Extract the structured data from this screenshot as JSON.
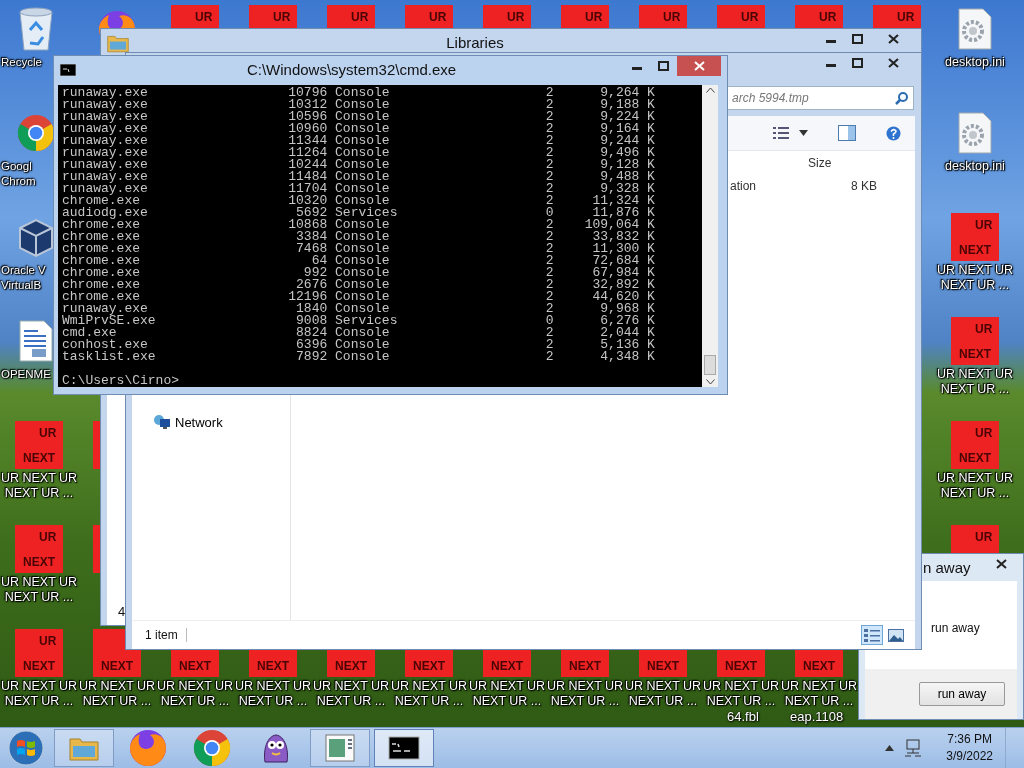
{
  "desktop": {
    "icons": [
      {
        "kind": "recycle-bin",
        "label": [
          "Recycle"
        ]
      },
      {
        "kind": "firefox"
      },
      {
        "kind": "tile",
        "top": "UR"
      },
      {
        "kind": "tile",
        "top": "UR"
      },
      {
        "kind": "tile",
        "top": "UR"
      },
      {
        "kind": "tile",
        "top": "UR"
      },
      {
        "kind": "tile",
        "top": "UR"
      },
      {
        "kind": "tile",
        "top": "UR"
      },
      {
        "kind": "tile",
        "top": "UR"
      },
      {
        "kind": "tile",
        "top": "UR"
      },
      {
        "kind": "tile",
        "top": "UR"
      },
      {
        "kind": "tile",
        "top": "UR"
      },
      {
        "kind": "settings-file",
        "label": [
          "desktop.ini"
        ]
      },
      {
        "kind": "chrome",
        "label": [
          "Googl",
          "Chrom"
        ]
      },
      {
        "kind": "settings-file",
        "label": [
          "desktop.ini"
        ]
      },
      {
        "kind": "virtualbox",
        "label": [
          "Oracle V",
          "VirtualB"
        ]
      },
      {
        "kind": "tile",
        "top": "UR",
        "bottom": "NEXT",
        "label": [
          "UR NEXT UR",
          "NEXT UR ..."
        ]
      },
      {
        "kind": "document",
        "label": [
          "OPENME"
        ]
      },
      {
        "kind": "tile",
        "top": "UR",
        "bottom": "NEXT",
        "label": [
          "UR NEXT UR",
          "NEXT UR ..."
        ]
      },
      {
        "kind": "tile",
        "top": "UR",
        "bottom": "NEXT",
        "label": [
          "UR NEXT UR",
          "NEXT UR ..."
        ]
      },
      {
        "kind": "tile"
      },
      {
        "kind": "tile",
        "top": "UR",
        "bottom": "NEXT",
        "label": [
          "UR NEXT UR",
          "NEXT UR ..."
        ]
      },
      {
        "kind": "tile",
        "top": "UR",
        "bottom": "NEXT",
        "label": [
          "UR NEXT UR",
          "NEXT UR ..."
        ]
      },
      {
        "kind": "tile"
      },
      {
        "kind": "tile",
        "top": "UR"
      },
      {
        "kind": "tile",
        "top": "UR",
        "bottom": "NEXT",
        "label": [
          "UR NEXT UR",
          "NEXT UR ..."
        ]
      },
      {
        "kind": "tile",
        "bottom": "NEXT",
        "label": [
          "UR NEXT UR",
          "NEXT UR ..."
        ]
      },
      {
        "kind": "tile",
        "bottom": "NEXT",
        "label": [
          "UR NEXT UR",
          "NEXT UR ..."
        ]
      },
      {
        "kind": "tile",
        "bottom": "NEXT",
        "label": [
          "UR NEXT UR",
          "NEXT UR ..."
        ]
      },
      {
        "kind": "tile",
        "bottom": "NEXT",
        "label": [
          "UR NEXT UR",
          "NEXT UR ..."
        ]
      },
      {
        "kind": "tile",
        "bottom": "NEXT",
        "label": [
          "UR NEXT UR",
          "NEXT UR ..."
        ]
      },
      {
        "kind": "tile",
        "bottom": "NEXT",
        "label": [
          "UR NEXT UR",
          "NEXT UR ..."
        ]
      },
      {
        "kind": "tile",
        "bottom": "NEXT",
        "label": [
          "UR NEXT UR",
          "NEXT UR ..."
        ]
      },
      {
        "kind": "tile",
        "bottom": "NEXT",
        "label": [
          "UR NEXT UR",
          "NEXT UR ..."
        ]
      },
      {
        "kind": "tile",
        "bottom": "NEXT",
        "label": [
          "UR NEXT UR",
          "NEXT UR ..."
        ]
      },
      {
        "kind": "tile",
        "bottom": "NEXT",
        "label": [
          "UR NEXT UR",
          "NEXT UR ..."
        ]
      }
    ],
    "stray_labels": [
      "64.fbl",
      "eap.1108"
    ]
  },
  "libraries_window": {
    "title": "Libraries",
    "active": false,
    "status_text": "4"
  },
  "dialog": {
    "title": "n away",
    "active": false,
    "message": "run away",
    "button": "run away"
  },
  "explorer_window": {
    "active": false,
    "search": {
      "placeholder": "arch 5994.tmp"
    },
    "column_header": "Size",
    "row": {
      "type": "ation",
      "size": "8 KB"
    },
    "nav_item": "Network",
    "status_text": "1 item",
    "view_buttons": [
      {
        "kind": "details",
        "selected": true
      },
      {
        "kind": "thumbnails",
        "selected": false
      }
    ]
  },
  "console_window": {
    "title": "C:\\Windows\\system32\\cmd.exe",
    "active": true,
    "lines": [
      "runaway.exe                  10796 Console                    2      9,264 K",
      "runaway.exe                  10312 Console                    2      9,188 K",
      "runaway.exe                  10596 Console                    2      9,224 K",
      "runaway.exe                  10960 Console                    2      9,164 K",
      "runaway.exe                  11344 Console                    2      9,244 K",
      "runaway.exe                  11264 Console                    2      9,496 K",
      "runaway.exe                  10244 Console                    2      9,128 K",
      "runaway.exe                  11484 Console                    2      9,488 K",
      "runaway.exe                  11704 Console                    2      9,328 K",
      "chrome.exe                   10320 Console                    2     11,324 K",
      "audiodg.exe                   5692 Services                   0     11,876 K",
      "chrome.exe                   10868 Console                    2    109,064 K",
      "chrome.exe                    3384 Console                    2     33,832 K",
      "chrome.exe                    7468 Console                    2     11,300 K",
      "chrome.exe                      64 Console                    2     72,684 K",
      "chrome.exe                     992 Console                    2     67,984 K",
      "chrome.exe                    2676 Console                    2     32,892 K",
      "chrome.exe                   12196 Console                    2     44,620 K",
      "runaway.exe                   1840 Console                    2      9,968 K",
      "WmiPrvSE.exe                  9008 Services                   0      6,276 K",
      "cmd.exe                       8824 Console                    2      2,044 K",
      "conhost.exe                   6396 Console                    2      5,136 K",
      "tasklist.exe                  7892 Console                    2      4,348 K"
    ],
    "prompt": "C:\\Users\\Cirno>"
  },
  "taskbar": {
    "items": [
      {
        "kind": "explorer",
        "running": true,
        "selected": false
      },
      {
        "kind": "firefox",
        "running": false,
        "selected": false
      },
      {
        "kind": "chrome",
        "running": false,
        "selected": false
      },
      {
        "kind": "mascot",
        "running": false,
        "selected": false
      },
      {
        "kind": "document-viewer",
        "running": true,
        "selected": false
      },
      {
        "kind": "console",
        "running": true,
        "selected": true
      }
    ],
    "time": "7:36 PM",
    "date": "3/9/2022"
  }
}
